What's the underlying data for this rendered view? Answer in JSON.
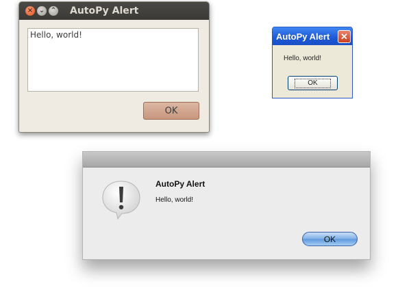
{
  "ubuntu_dialog": {
    "title": "AutoPy Alert",
    "message": "Hello, world!",
    "ok_label": "OK",
    "close_glyph": "×",
    "min_glyph": "⌄",
    "max_glyph": "⌃"
  },
  "xp_dialog": {
    "title": "AutoPy Alert",
    "close_glyph": "✕",
    "message": "Hello, world!",
    "ok_label": "OK"
  },
  "mac_dialog": {
    "title": "AutoPy Alert",
    "message": "Hello, world!",
    "ok_label": "OK",
    "icon": "exclamation-bubble-icon"
  },
  "colors": {
    "ubuntu_titlebar": "#3a3935",
    "ubuntu_close": "#df4b16",
    "ubuntu_ok": "#c8967f",
    "xp_titlebar": "#1d57d8",
    "xp_close": "#c9401f",
    "mac_ok": "#5d98de"
  }
}
